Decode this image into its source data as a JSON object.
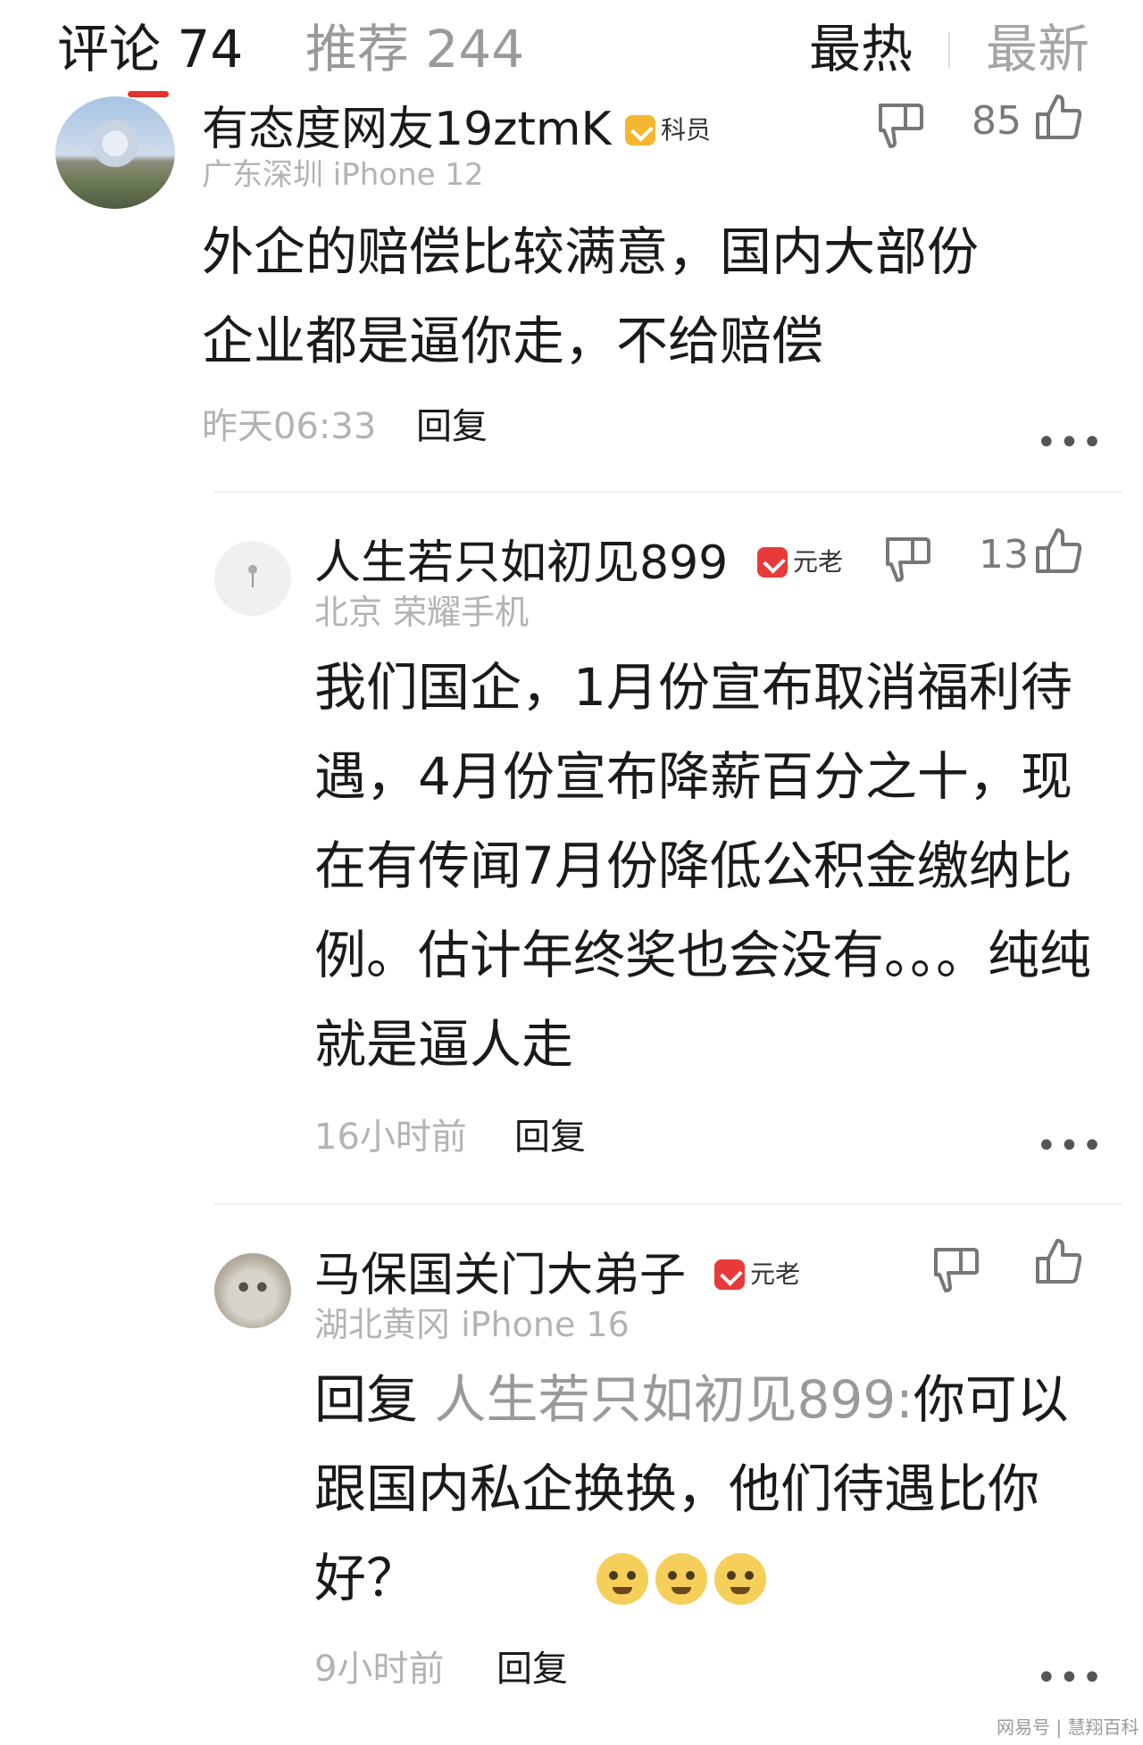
{
  "header": {
    "comments_tab": "评论 74",
    "recommend_tab": "推荐 244",
    "sort_hot": "最热",
    "sort_new": "最新"
  },
  "comments": [
    {
      "username": "有态度网友19ztmK",
      "badge": "科员",
      "badge_color": "#f5b731",
      "meta": "广东深圳  iPhone 12",
      "text": "外企的赔偿比较满意，国内大部份企业都是逼你走，不给赔偿",
      "time": "昨天06:33",
      "reply": "回复",
      "like_count": "85"
    },
    {
      "username": "人生若只如初见899",
      "badge": "元老",
      "badge_color": "#e83a3a",
      "meta": "北京  荣耀手机",
      "text": "我们国企，1月份宣布取消福利待遇，4月份宣布降薪百分之十，现在有传闻7月份降低公积金缴纳比例。估计年终奖也会没有。。。纯纯就是逼人走",
      "time": "16小时前",
      "reply": "回复",
      "like_count": "13"
    },
    {
      "username": "马保国关门大弟子",
      "badge": "元老",
      "badge_color": "#e83a3a",
      "meta": "湖北黄冈  iPhone 16",
      "reply_prefix": "回复 ",
      "reply_to": "人生若只如初见899:",
      "text": "你可以跟国内私企换换，他们待遇比你好？",
      "time": "9小时前",
      "reply": "回复",
      "like_count": ""
    }
  ],
  "more_glyph": "•••",
  "watermark": "网易号 | 慧翔百科"
}
